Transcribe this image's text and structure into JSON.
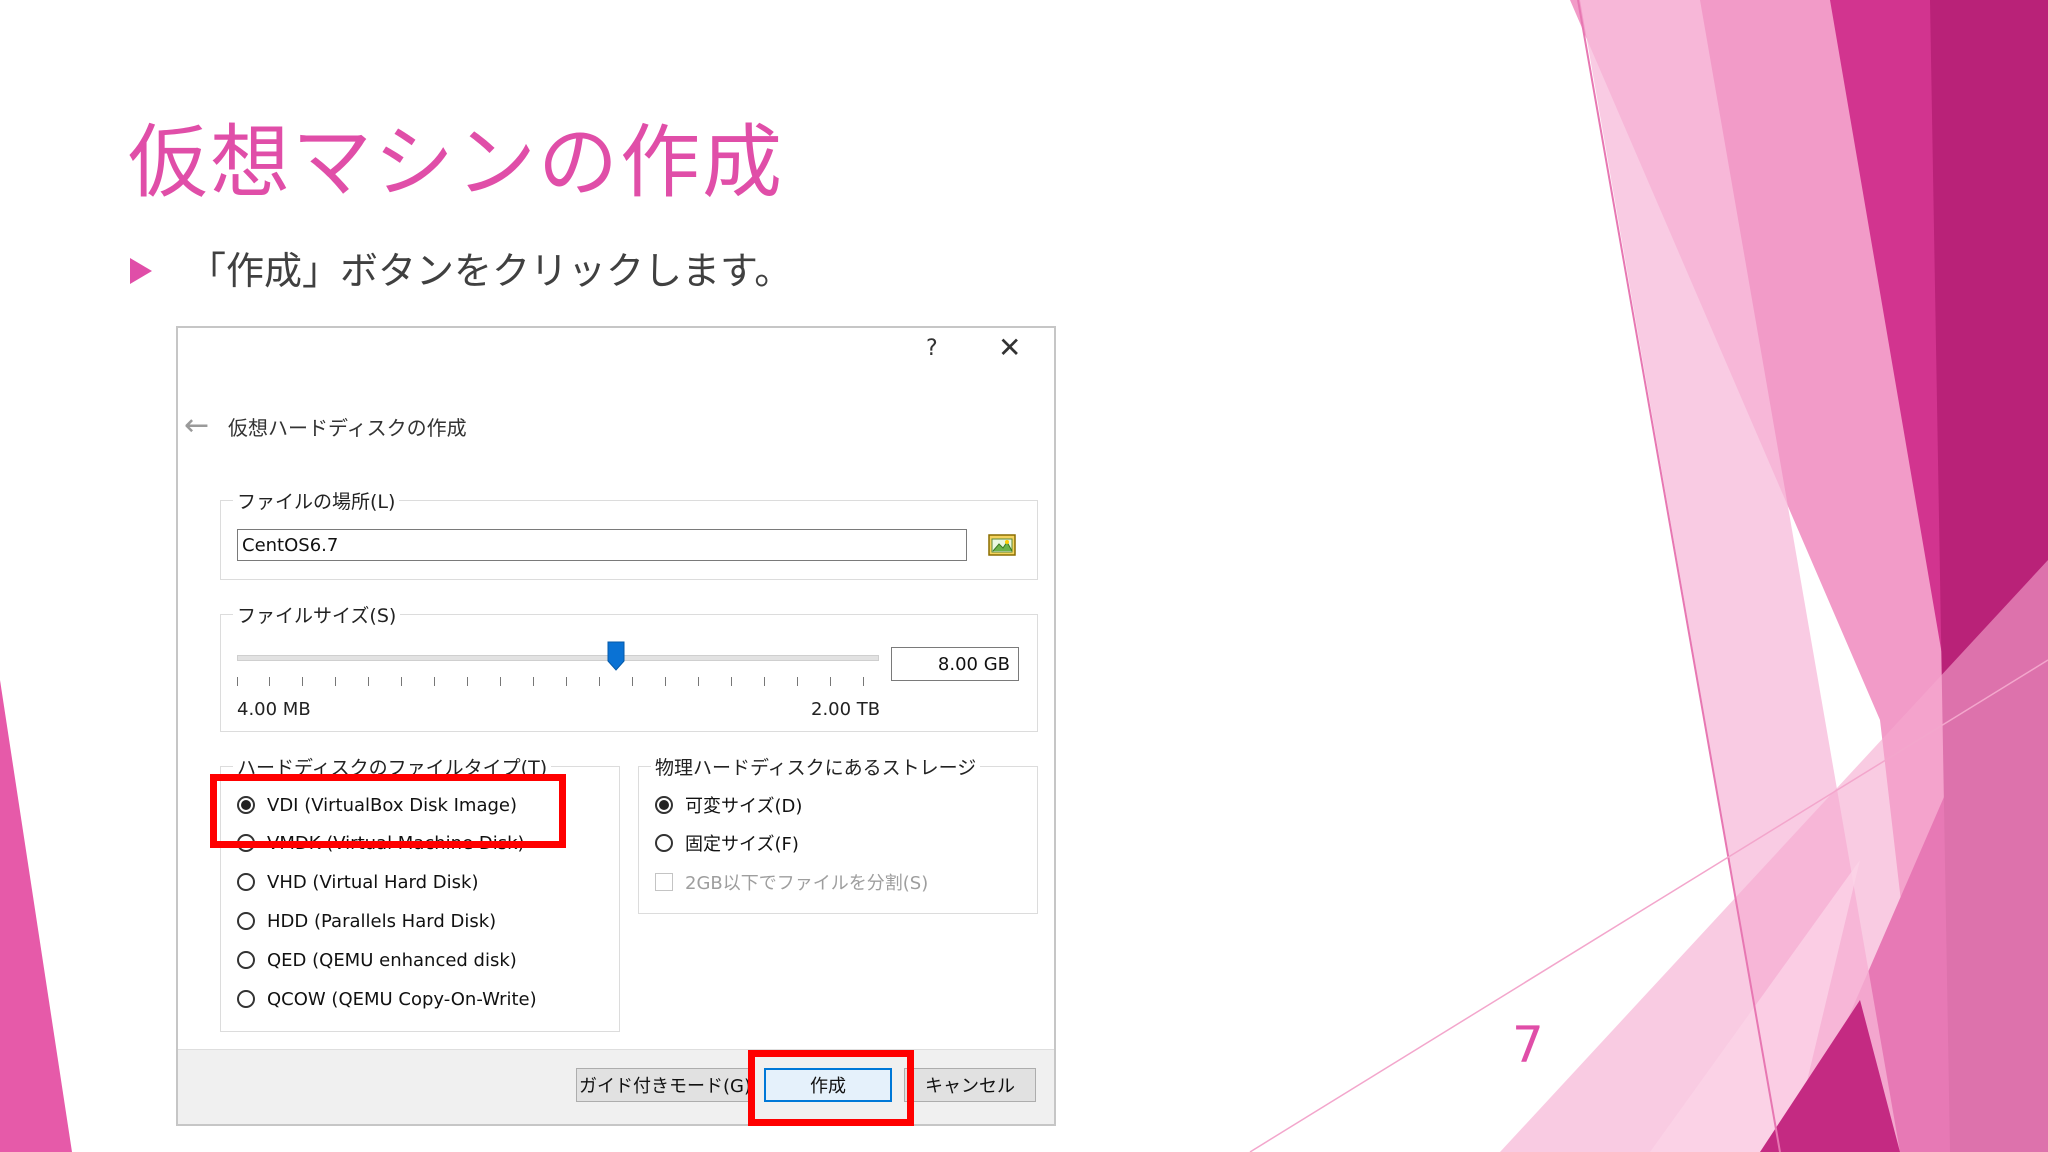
{
  "slide": {
    "title": "仮想マシンの作成",
    "bullet": "「作成」ボタンをクリックします。",
    "page_number": "7",
    "accent_color": "#e04ea8",
    "highlight_color": "#ff0000"
  },
  "dialog": {
    "help_label": "?",
    "close_label": "✕",
    "back_icon": "←",
    "title": "仮想ハードディスクの作成",
    "file_location": {
      "label": "ファイルの場所(L)",
      "value": "CentOS6.7"
    },
    "file_size": {
      "label": "ファイルサイズ(S)",
      "min_label": "4.00 MB",
      "max_label": "2.00 TB",
      "value": "8.00 GB"
    },
    "disk_type": {
      "label": "ハードディスクのファイルタイプ(T)",
      "options": [
        {
          "label": "VDI (VirtualBox Disk Image)",
          "checked": true
        },
        {
          "label": "VMDK (Virtual Machine Disk)",
          "checked": false
        },
        {
          "label": "VHD (Virtual Hard Disk)",
          "checked": false
        },
        {
          "label": "HDD (Parallels Hard Disk)",
          "checked": false
        },
        {
          "label": "QED (QEMU enhanced disk)",
          "checked": false
        },
        {
          "label": "QCOW (QEMU Copy-On-Write)",
          "checked": false
        }
      ]
    },
    "storage": {
      "label": "物理ハードディスクにあるストレージ",
      "options": [
        {
          "label": "可変サイズ(D)",
          "checked": true
        },
        {
          "label": "固定サイズ(F)",
          "checked": false
        }
      ],
      "split_checkbox": "2GB以下でファイルを分割(S)"
    },
    "buttons": {
      "guided": "ガイド付きモード(G)",
      "create": "作成",
      "cancel": "キャンセル"
    }
  }
}
